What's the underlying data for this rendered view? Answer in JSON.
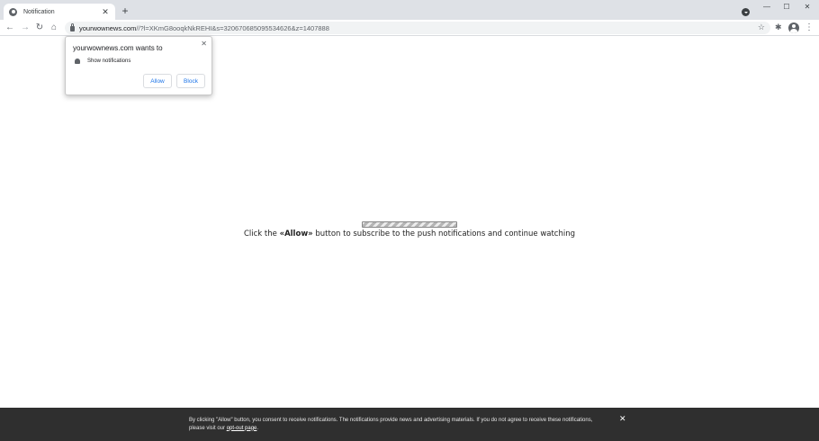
{
  "tab": {
    "title": "Notification",
    "close_glyph": "✕",
    "new_tab_glyph": "+"
  },
  "window_controls": {
    "minimize": "—",
    "maximize": "☐",
    "close": "✕"
  },
  "toolbar": {
    "back": "←",
    "forward": "→",
    "reload": "↻",
    "home": "⌂",
    "url_host": "yourwownews.com",
    "url_path": "//?l=XKmG8ooqkNkREHI&s=32067068509553462​6&z=1407888",
    "star": "☆",
    "extensions": "✱",
    "menu": "⋮"
  },
  "popup": {
    "title": "yourwownews.com wants to",
    "close_glyph": "✕",
    "permission": "Show notifications",
    "allow_label": "Allow",
    "block_label": "Block"
  },
  "content": {
    "message_before": "Click the ",
    "message_bold": "«Allow»",
    "message_after": " button to subscribe to the push notifications and continue watching"
  },
  "consent": {
    "text": "By clicking \"Allow\" button, you consent to receive notifications. The notifications provide news and advertising materials. If you do not agree to receive these notifications, please visit our ",
    "link": "opt-out page",
    "end": ".",
    "close_glyph": "✕"
  },
  "colors": {
    "accent": "#1a73e8",
    "consent_bg": "#2f2f2f",
    "tabstrip_bg": "#dee1e6"
  }
}
